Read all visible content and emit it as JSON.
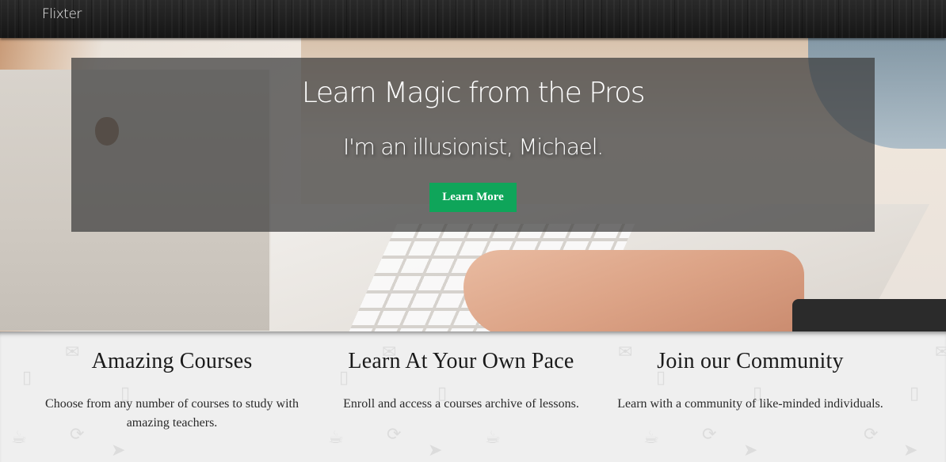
{
  "nav": {
    "brand": "Flixter"
  },
  "hero": {
    "title": "Learn Magic from the Pros",
    "subtitle": "I'm an illusionist, Michael.",
    "button_label": "Learn More",
    "button_color": "#0fa55a"
  },
  "features": [
    {
      "title": "Amazing Courses",
      "text": "Choose from any number of courses to study with amazing teachers."
    },
    {
      "title": "Learn At Your Own Pace",
      "text": "Enroll and access a courses archive of lessons."
    },
    {
      "title": "Join our Community",
      "text": "Learn with a community of like-minded individuals."
    }
  ]
}
